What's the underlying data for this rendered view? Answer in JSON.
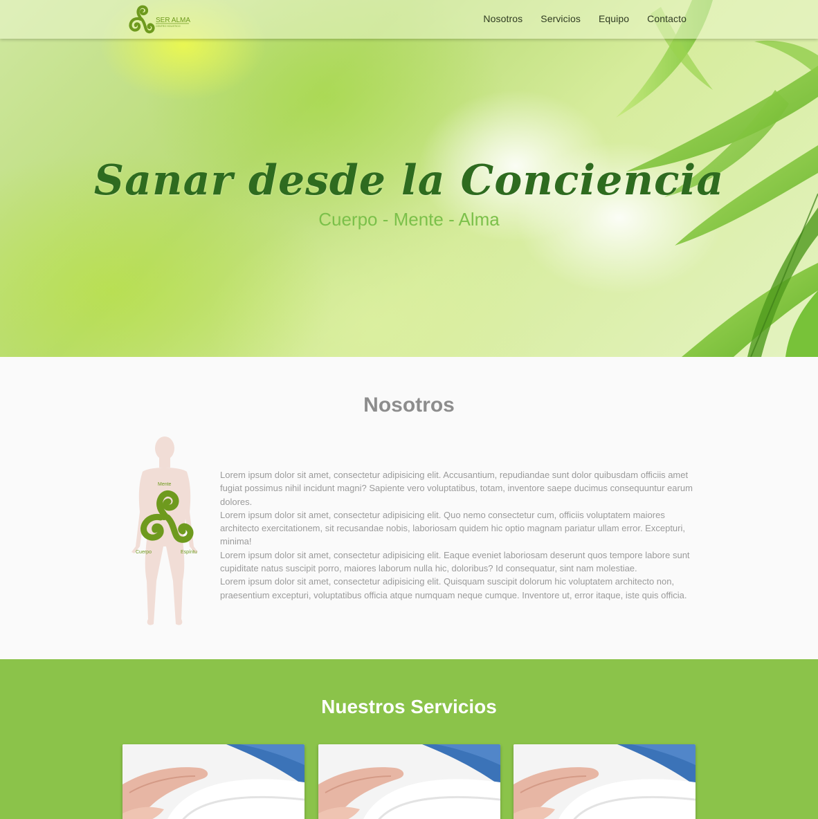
{
  "brand": {
    "name": "SER ALMA",
    "tagline": "CENTRO HOLISTICO",
    "logo_icon": "triskelion-icon",
    "accent_color": "#8bc34a",
    "dark_green": "#2e6b1f"
  },
  "nav": {
    "items": [
      {
        "label": "Nosotros"
      },
      {
        "label": "Servicios"
      },
      {
        "label": "Equipo"
      },
      {
        "label": "Contacto"
      }
    ]
  },
  "hero": {
    "title": "Sanar desde la Conciencia",
    "subtitle": "Cuerpo - Mente - Alma"
  },
  "about": {
    "title": "Nosotros",
    "figure_labels": {
      "top": "Mente",
      "left": "Cuerpo",
      "right": "Espíritu"
    },
    "paragraphs": [
      "Lorem ipsum dolor sit amet, consectetur adipisicing elit. Accusantium, repudiandae sunt dolor quibusdam officiis amet fugiat possimus nihil incidunt magni? Sapiente vero voluptatibus, totam, inventore saepe ducimus consequuntur earum dolores.",
      "Lorem ipsum dolor sit amet, consectetur adipisicing elit. Quo nemo consectetur cum, officiis voluptatem maiores architecto exercitationem, sit recusandae nobis, laboriosam quidem hic optio magnam pariatur ullam error. Excepturi, minima!",
      "Lorem ipsum dolor sit amet, consectetur adipisicing elit. Eaque eveniet laboriosam deserunt quos tempore labore sunt cupiditate natus suscipit porro, maiores laborum nulla hic, doloribus? Id consequatur, sint nam molestiae.",
      "Lorem ipsum dolor sit amet, consectetur adipisicing elit. Quisquam suscipit dolorum hic voluptatem architecto non, praesentium excepturi, voluptatibus officia atque numquam neque cumque. Inventore ut, error itaque, iste quis officia."
    ]
  },
  "services": {
    "title": "Nuestros Servicios",
    "cards": [
      {
        "image": "massage-towel-image"
      },
      {
        "image": "massage-towel-image"
      },
      {
        "image": "massage-towel-image"
      }
    ]
  }
}
